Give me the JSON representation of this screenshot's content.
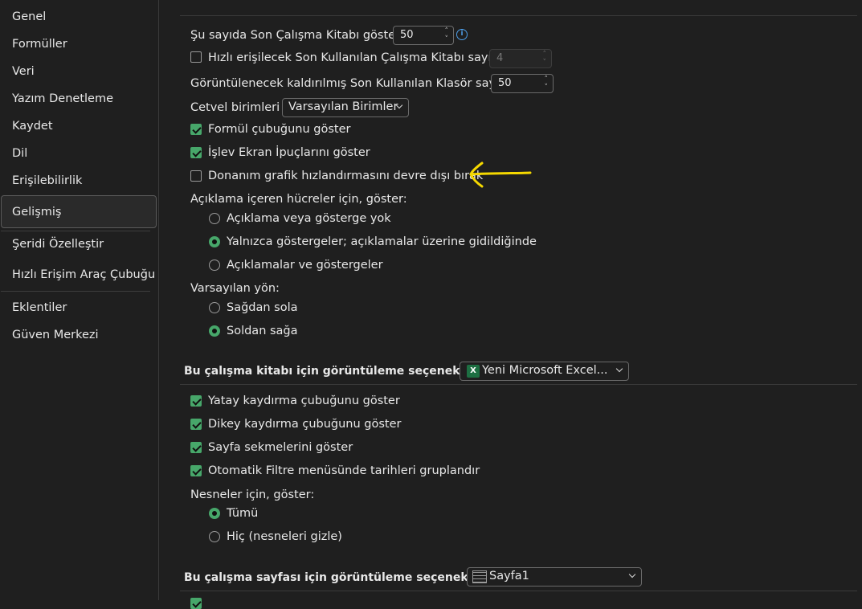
{
  "sidebar": {
    "items": [
      {
        "label": "Genel"
      },
      {
        "label": "Formüller"
      },
      {
        "label": "Veri"
      },
      {
        "label": "Yazım Denetleme"
      },
      {
        "label": "Kaydet"
      },
      {
        "label": "Dil"
      },
      {
        "label": "Erişilebilirlik"
      },
      {
        "label": "Gelişmiş"
      },
      {
        "label": "Şeridi Özelleştir"
      },
      {
        "label": "Hızlı Erişim Araç Çubuğu"
      },
      {
        "label": "Eklentiler"
      },
      {
        "label": "Güven Merkezi"
      }
    ],
    "selected": "Gelişmiş"
  },
  "display": {
    "recent_count_label": "Şu sayıda Son Çalışma Kitabı göster:",
    "recent_count_value": "50",
    "quick_access": {
      "label": "Hızlı erişilecek Son Kullanılan Çalışma Kitabı sayısı:",
      "checked": false,
      "value": "4"
    },
    "unpinned_folders_label": "Görüntülenecek kaldırılmış Son Kullanılan Klasör sayısı:",
    "unpinned_folders_value": "50",
    "ruler_units_label": "Cetvel birimleri",
    "ruler_units_value": "Varsayılan Birimler",
    "show_formula_bar": {
      "label": "Formül çubuğunu göster",
      "checked": true
    },
    "show_function_tips": {
      "label": "İşlev Ekran İpuçlarını göster",
      "checked": true
    },
    "disable_hw_accel": {
      "label": "Donanım grafik hızlandırmasını devre dışı bırak",
      "checked": false
    },
    "comments_heading": "Açıklama içeren hücreler için, göster:",
    "comments_options": [
      {
        "label": "Açıklama veya gösterge yok",
        "selected": false
      },
      {
        "label": "Yalnızca göstergeler; açıklamalar üzerine gidildiğinde",
        "selected": true
      },
      {
        "label": "Açıklamalar ve göstergeler",
        "selected": false
      }
    ],
    "direction_heading": "Varsayılan yön:",
    "direction_options": [
      {
        "label": "Sağdan sola",
        "selected": false
      },
      {
        "label": "Soldan sağa",
        "selected": true
      }
    ]
  },
  "workbook_section": {
    "title": "Bu çalışma kitabı için görüntüleme seçenekleri:",
    "workbook_name": "Yeni Microsoft Excel...",
    "show_hscroll": {
      "label": "Yatay kaydırma çubuğunu göster",
      "checked": true
    },
    "show_vscroll": {
      "label": "Dikey kaydırma çubuğunu göster",
      "checked": true
    },
    "show_sheet_tabs": {
      "label": "Sayfa sekmelerini göster",
      "checked": true
    },
    "group_dates": {
      "label": "Otomatik Filtre menüsünde tarihleri gruplandır",
      "checked": true
    },
    "objects_heading": "Nesneler için, göster:",
    "objects_options": [
      {
        "label": "Tümü",
        "selected": true
      },
      {
        "label": "Hiç (nesneleri gizle)",
        "selected": false
      }
    ]
  },
  "worksheet_section": {
    "title": "Bu çalışma sayfası için görüntüleme seçenekleri:",
    "sheet_name": "Sayfa1"
  },
  "colors": {
    "accent": "#47a76a",
    "annotation": "#f5d800",
    "background": "#1f1f1f"
  }
}
